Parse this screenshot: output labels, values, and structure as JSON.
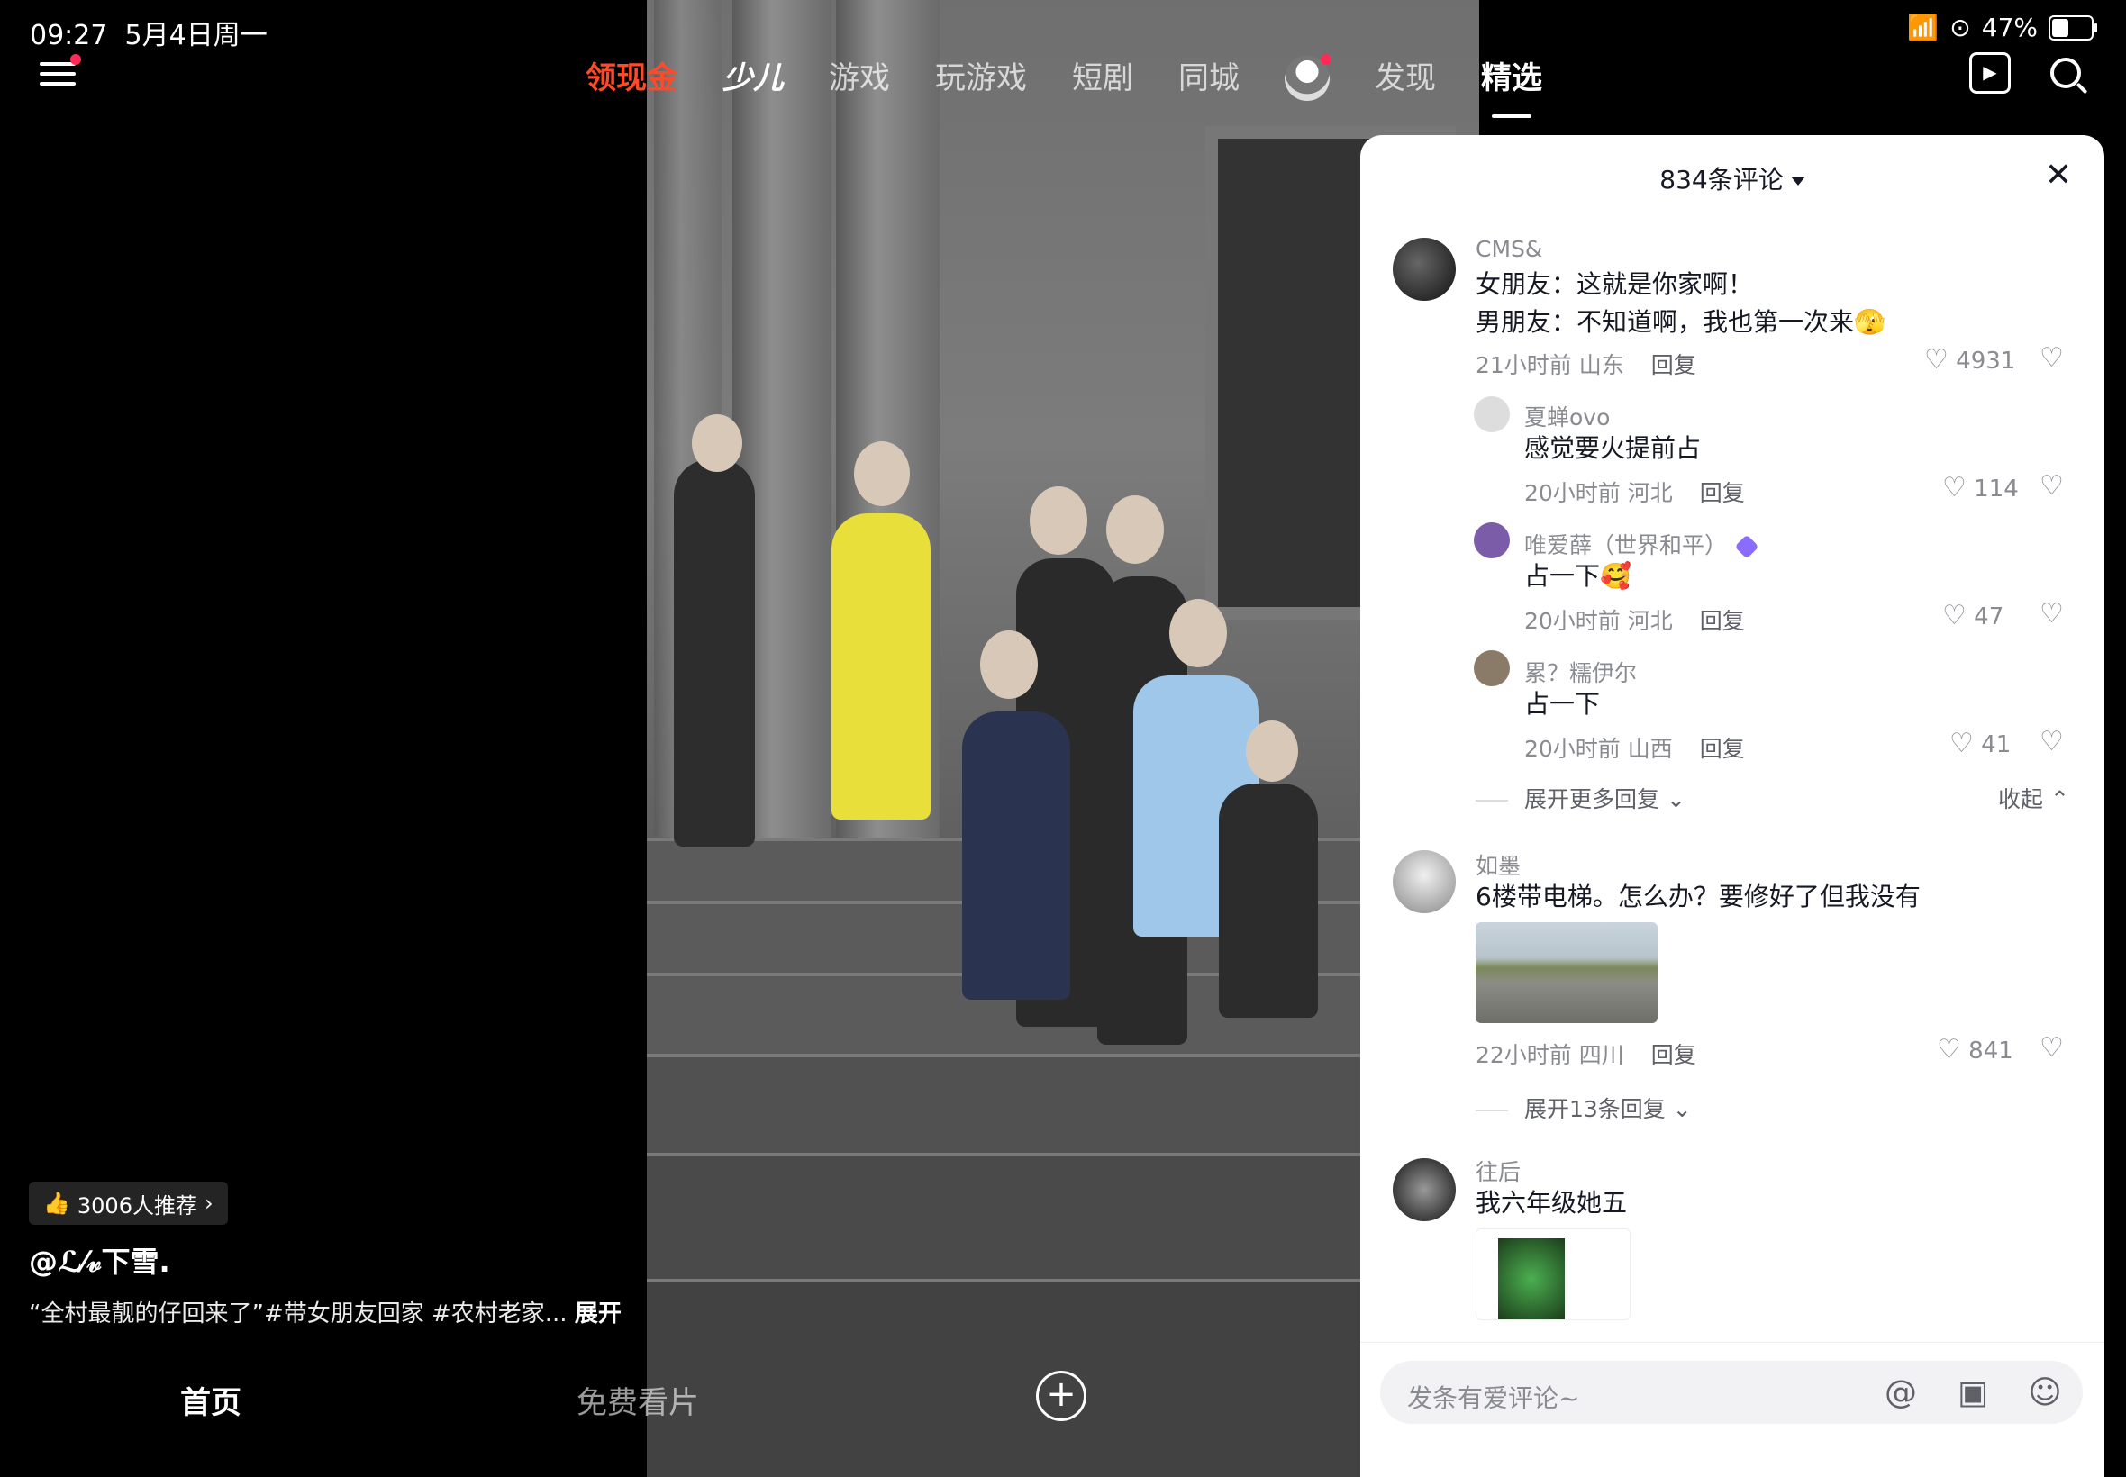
{
  "status": {
    "time": "09:27",
    "date": "5月4日周一",
    "battery": "47%"
  },
  "nav": {
    "tabs": [
      "领现金",
      "少儿",
      "游戏",
      "玩游戏",
      "短剧",
      "同城",
      "发现",
      "精选"
    ],
    "active": "精选"
  },
  "video": {
    "recommend": "3006人推荐",
    "author": "@ℒ⁄𝓋下雪.",
    "caption": "“全村最靓的仔回来了”#带女朋友回家 #农村老家...",
    "caption_more": "展开"
  },
  "bottom": {
    "home": "首页",
    "free": "免费看片",
    "plus": "+"
  },
  "comments": {
    "header": "834条评论",
    "items": [
      {
        "user": "CMS&",
        "line1": "女朋友：这就是你家啊！",
        "line2": "男朋友：不知道啊，我也第一次来🫣",
        "meta": "21小时前 山东",
        "reply": "回复",
        "likes": "4931"
      },
      {
        "user": "夏蝉ovo",
        "text": "感觉要火提前占",
        "meta": "20小时前 河北",
        "reply": "回复",
        "likes": "114"
      },
      {
        "user": "唯爱薛（世界和平）",
        "text": "占一下🥰",
        "meta": "20小时前 河北",
        "reply": "回复",
        "likes": "47"
      },
      {
        "user": "累？糯伊尔",
        "text": "占一下",
        "meta": "20小时前 山西",
        "reply": "回复",
        "likes": "41"
      },
      {
        "user": "如墨",
        "text": "6楼带电梯。怎么办？要修好了但我没有",
        "meta": "22小时前 四川",
        "reply": "回复",
        "likes": "841"
      },
      {
        "user": "往后",
        "text": "我六年级她五"
      }
    ],
    "expand_more": "展开更多回复",
    "collapse": "收起",
    "expand_13": "展开13条回复",
    "input_placeholder": "发条有爱评论~"
  }
}
